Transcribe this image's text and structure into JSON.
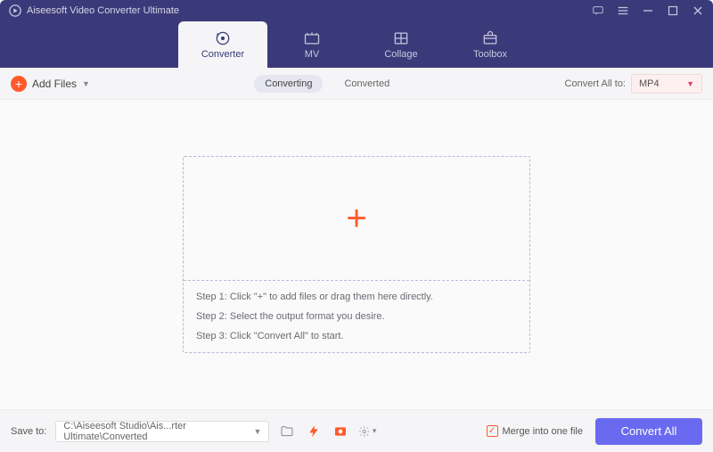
{
  "app": {
    "title": "Aiseesoft Video Converter Ultimate"
  },
  "nav": {
    "tabs": [
      {
        "label": "Converter"
      },
      {
        "label": "MV"
      },
      {
        "label": "Collage"
      },
      {
        "label": "Toolbox"
      }
    ]
  },
  "toolbar": {
    "add_label": "Add Files",
    "seg_converting": "Converting",
    "seg_converted": "Converted",
    "convert_all_to": "Convert All to:",
    "format_selected": "MP4"
  },
  "dropzone": {
    "step1": "Step 1: Click \"+\" to add files or drag them here directly.",
    "step2": "Step 2: Select the output format you desire.",
    "step3": "Step 3: Click \"Convert All\" to start."
  },
  "footer": {
    "save_to_label": "Save to:",
    "path": "C:\\Aiseesoft Studio\\Ais...rter Ultimate\\Converted",
    "merge_label": "Merge into one file",
    "convert_all_btn": "Convert All"
  }
}
